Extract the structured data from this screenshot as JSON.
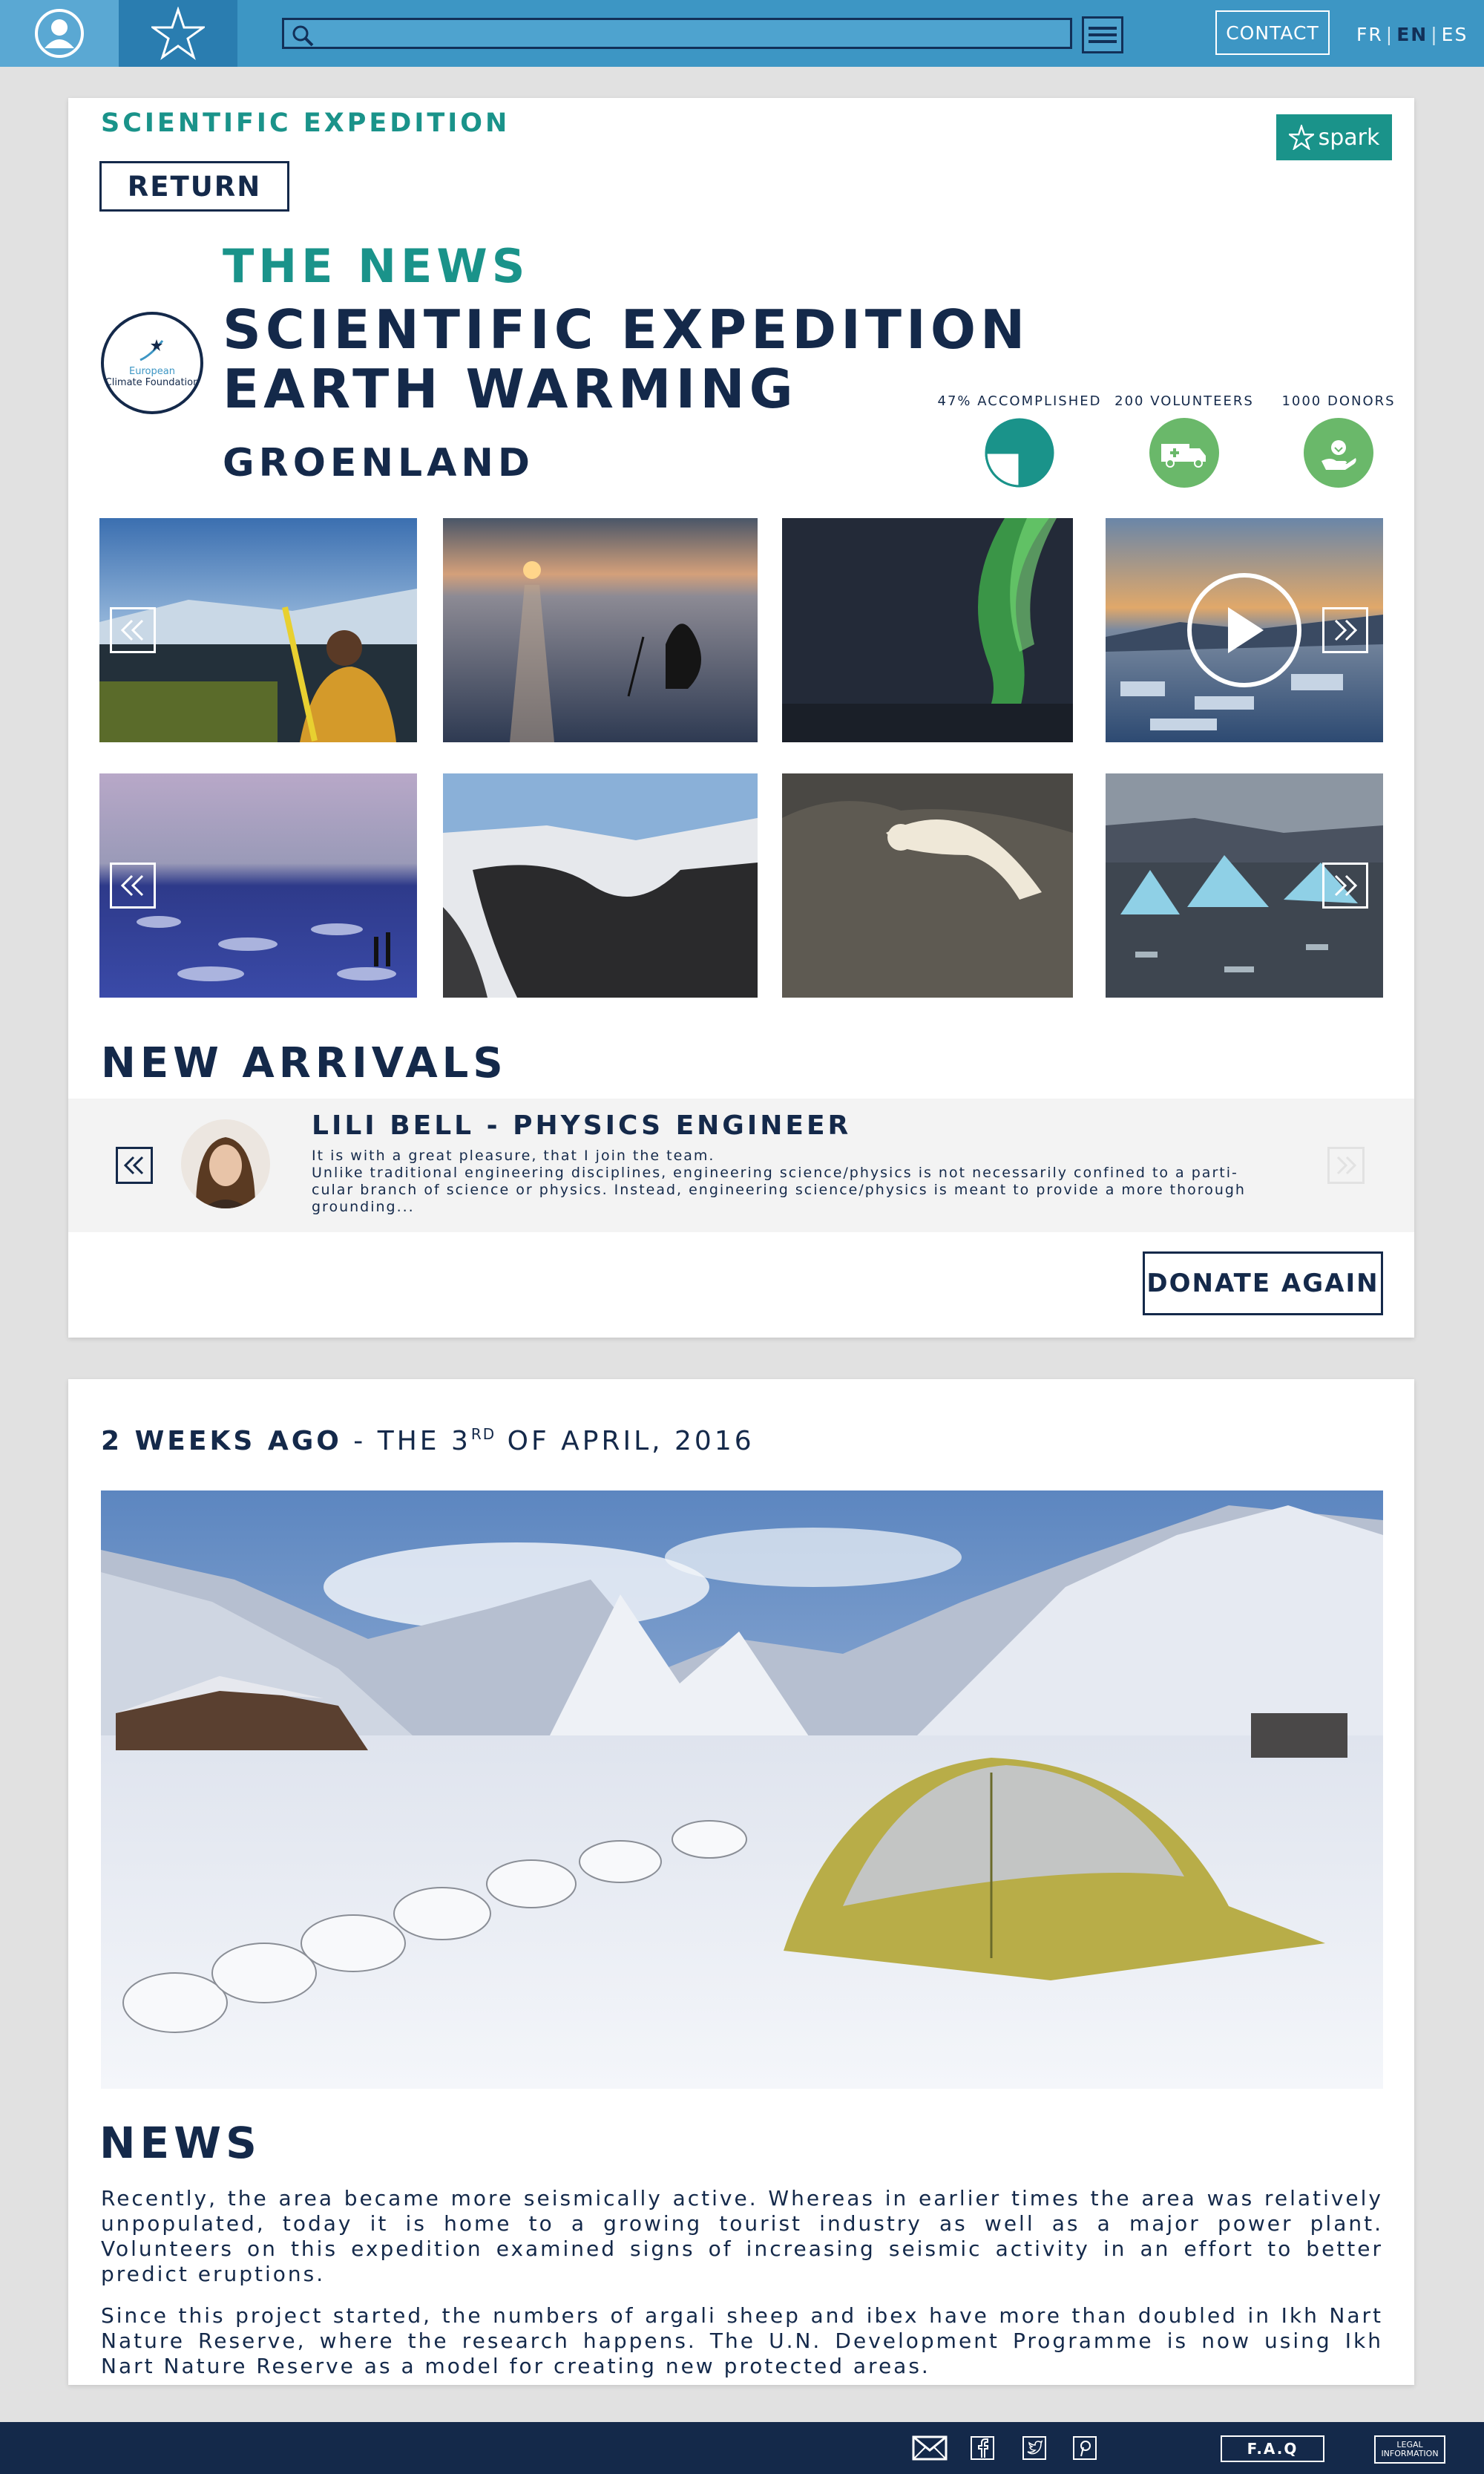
{
  "topbar": {
    "search_placeholder": "",
    "contact_label": "CONTACT",
    "languages": [
      "FR",
      "EN",
      "ES"
    ],
    "active_language": "EN"
  },
  "card1": {
    "section_title": "SCIENTIFIC EXPEDITION",
    "spark_label": "spark",
    "return_label": "RETURN",
    "logo_line1": "European",
    "logo_line2": "Climate Foundation",
    "kicker": "THE NEWS",
    "headline_line1": "SCIENTIFIC EXPEDITION",
    "headline_line2": "EARTH WARMING",
    "location": "GROENLAND",
    "stats": [
      {
        "label": "47% ACCOMPLISHED",
        "value": 0.47
      },
      {
        "label": "200 VOLUNTEERS"
      },
      {
        "label": "1000 DONORS"
      }
    ],
    "arrivals_title": "NEW ARRIVALS",
    "person_name": "LILI BELL - PHYSICS ENGINEER",
    "person_text_line1": "It is with a great pleasure, that I join the team.",
    "person_text_line2": "Unlike traditional engineering disciplines, engineering science/physics is not necessarily confined to a parti-",
    "person_text_line3": "cular branch of science or physics. Instead, engineering science/physics is meant to provide a more thorough",
    "person_text_line4": "grounding...",
    "donate_label": "DONATE AGAIN"
  },
  "card2": {
    "date_strong": "2 WEEKS AGO",
    "date_sep": " - THE 3",
    "date_sup": "RD",
    "date_rest": " OF APRIL, 2016",
    "news_title": "NEWS",
    "paragraph1": "Recently, the area became more seismically active. Whereas in earlier times the area was relatively unpopulated, today it is home to a growing tourist industry as well as a major power plant. Volunteers on this expedition examined signs of increasing seismic activity in an effort to better predict eruptions.",
    "paragraph2": "Since this project started, the numbers of argali sheep and ibex have more than doubled in Ikh Nart Nature Reserve, where the research happens. The U.N. Development Programme is now using Ikh Nart Nature Reserve as a model for creating new protected areas."
  },
  "footer": {
    "faq_label": "F.A.Q",
    "legal_line1": "LEGAL",
    "legal_line2": "INFORMATION",
    "icons": [
      "mail-icon",
      "facebook-icon",
      "twitter-icon",
      "pinterest-icon"
    ]
  },
  "colors": {
    "topbar": "#3d96c4",
    "teal": "#1a938a",
    "navy": "#14294a",
    "green": "#6ab86a"
  }
}
